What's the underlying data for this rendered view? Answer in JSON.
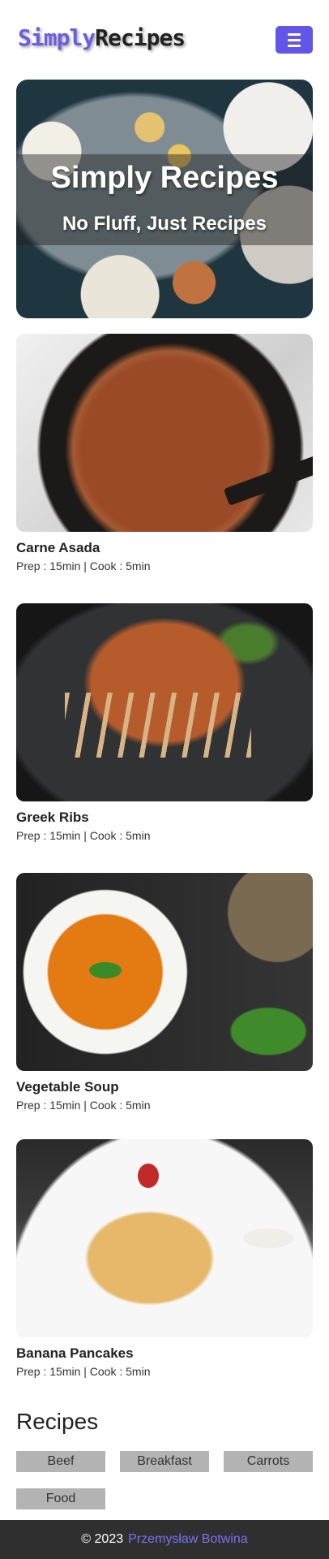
{
  "navbar": {
    "logo_part1": "Simply",
    "logo_part2": "Recipes",
    "menu_icon": "hamburger-icon"
  },
  "hero": {
    "title": "Simply Recipes",
    "subtitle": "No Fluff, Just Recipes"
  },
  "recipes": [
    {
      "name": "Carne Asada",
      "meta": "Prep : 15min | Cook : 5min"
    },
    {
      "name": "Greek Ribs",
      "meta": "Prep : 15min | Cook : 5min"
    },
    {
      "name": "Vegetable Soup",
      "meta": "Prep : 15min | Cook : 5min"
    },
    {
      "name": "Banana Pancakes",
      "meta": "Prep : 15min | Cook : 5min"
    }
  ],
  "tags_section": {
    "title": "Recipes",
    "tags": [
      "Beef",
      "Breakfast",
      "Carrots",
      "Food"
    ]
  },
  "footer": {
    "copyright": "© 2023",
    "author": "Przemysław Botwina"
  },
  "colors": {
    "accent": "#6156e8",
    "footer_bg": "#2f2f2f",
    "tag_bg": "#b3b3b3"
  }
}
